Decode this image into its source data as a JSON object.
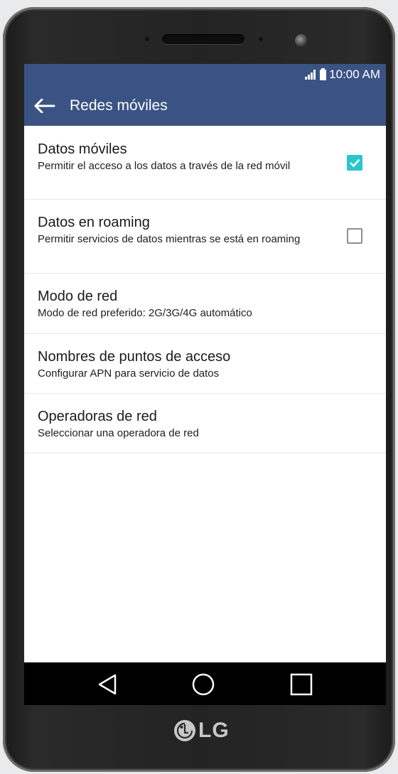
{
  "status_bar": {
    "time": "10:00 AM"
  },
  "toolbar": {
    "title": "Redes móviles"
  },
  "settings": [
    {
      "title": "Datos móviles",
      "subtitle": "Permitir el acceso a los datos a través de la red móvil",
      "checkbox": "checked"
    },
    {
      "title": "Datos en roaming",
      "subtitle": "Permitir servicios de datos mientras se está en roaming",
      "checkbox": "unchecked"
    },
    {
      "title": "Modo de red",
      "subtitle": "Modo de red preferido: 2G/3G/4G automático"
    },
    {
      "title": "Nombres de puntos de acceso",
      "subtitle": "Configurar APN para servicio de datos"
    },
    {
      "title": "Operadoras de red",
      "subtitle": "Seleccionar una operadora de red"
    }
  ],
  "brand": {
    "logo_text": "LG"
  },
  "colors": {
    "accent": "#3a5383",
    "checkbox_on": "#2bc5cc"
  }
}
